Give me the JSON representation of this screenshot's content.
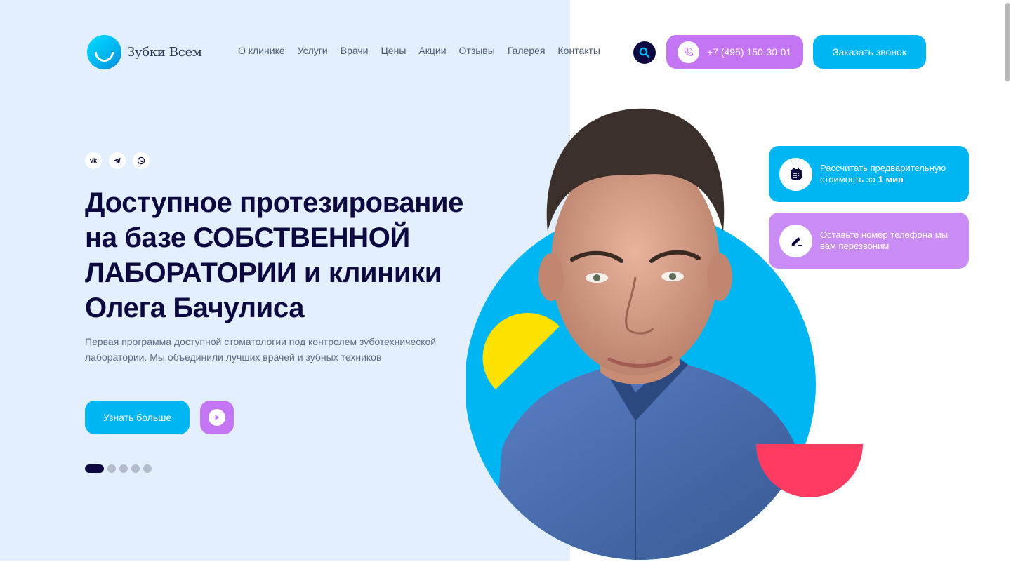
{
  "brand": {
    "name": "Зубки Всем"
  },
  "nav": {
    "items": [
      "О клинике",
      "Услуги",
      "Врачи",
      "Цены",
      "Акции",
      "Отзывы",
      "Галерея",
      "Контакты"
    ]
  },
  "header": {
    "phone": "+7 (495) 150-30-01",
    "callback_label": "Заказать звонок"
  },
  "socials": [
    {
      "label": "vk",
      "icon": "vk-icon"
    },
    {
      "label": "",
      "icon": "telegram-icon"
    },
    {
      "label": "",
      "icon": "whatsapp-icon"
    }
  ],
  "hero": {
    "headline_line1": "Доступное протезирование",
    "headline_line2_regular": "на базе ",
    "headline_line2_bold": "СОБСТВЕННОЙ",
    "headline_line3_bold": "ЛАБОРАТОРИИ",
    "headline_line3_regular": " и клиники",
    "headline_line4": "Олега Бачулиса",
    "subtitle": "Первая программа доступной стоматологии под контролем зуботехнической лаборатории. Мы объединили лучших врачей и зубных техников",
    "more_label": "Узнать больше"
  },
  "slider": {
    "count": 5,
    "active_index": 0
  },
  "cards": {
    "calc": {
      "text": "Рассчитать предварительную стоимость за ",
      "bold": "1 мин",
      "icon": "calendar-icon"
    },
    "phone": {
      "text": "Оставьте номер телефона мы вам перезвоним",
      "icon": "pen-icon"
    }
  },
  "colors": {
    "primary_dark": "#0d0940",
    "accent_blue": "#00b6f2",
    "accent_purple": "#c475f3",
    "accent_yellow": "#fde100",
    "accent_red": "#ff3b62",
    "hero_bg": "#e3effd"
  }
}
